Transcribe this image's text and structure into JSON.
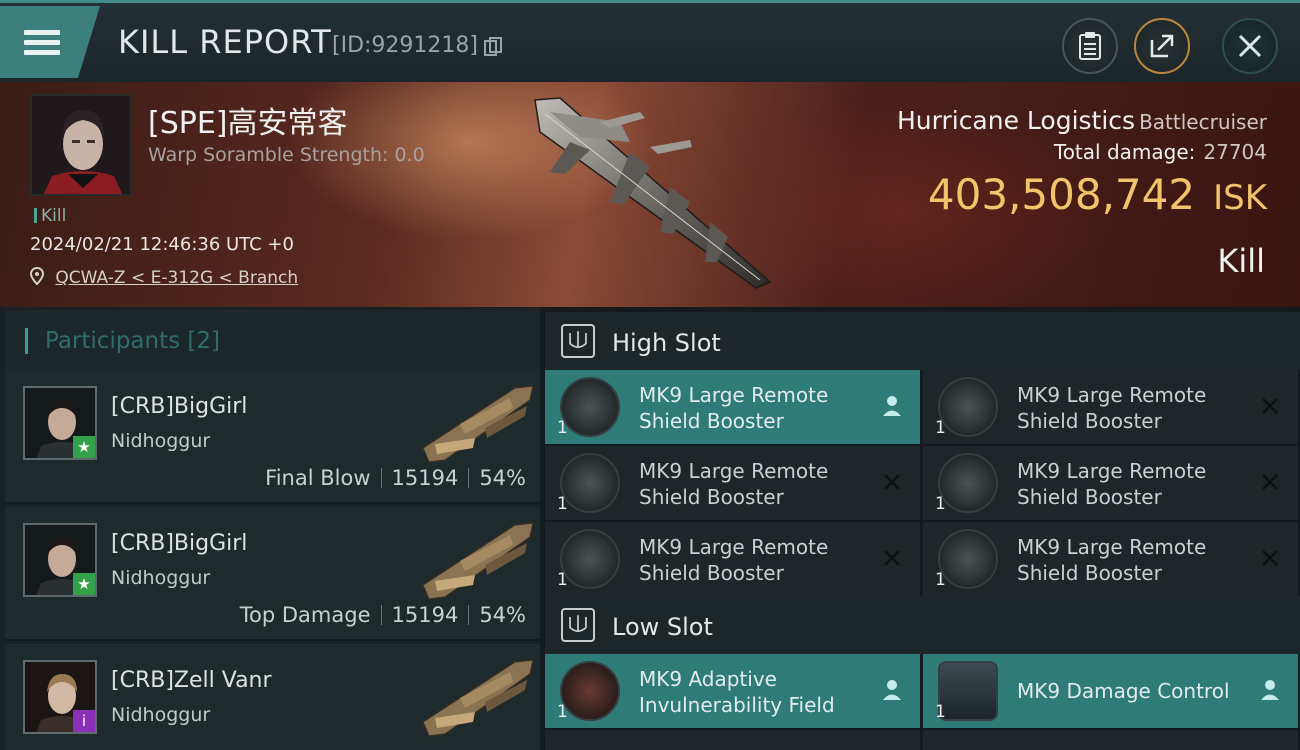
{
  "header": {
    "title": "KILL REPORT",
    "report_id": "[ID:9291218]"
  },
  "victim": {
    "name": "[SPE]高安常客",
    "warp_scramble": "Warp Soramble Strength: 0.0",
    "tag": "Kill",
    "datetime": "2024/02/21 12:46:36 UTC +0",
    "location": "QCWA-Z < E-312G < Branch",
    "ship_name": "Hurricane Logistics",
    "ship_class": "Battlecruiser",
    "total_damage_label": "Total damage:",
    "total_damage": "27704",
    "isk_value": "403,508,742",
    "isk_unit": "ISK",
    "result": "Kill"
  },
  "participants": {
    "label": "Participants",
    "count": "[2]",
    "rows": [
      {
        "name": "[CRB]BigGirl",
        "ship": "Nidhoggur",
        "role": "Final Blow",
        "damage": "15194",
        "percent": "54%",
        "badge": "★"
      },
      {
        "name": "[CRB]BigGirl",
        "ship": "Nidhoggur",
        "role": "Top Damage",
        "damage": "15194",
        "percent": "54%",
        "badge": "★"
      },
      {
        "name": "[CRB]Zell Vanr",
        "ship": "Nidhoggur",
        "role": "",
        "damage": "",
        "percent": "",
        "badge": "i"
      }
    ]
  },
  "slots": {
    "high_label": "High Slot",
    "low_label": "Low Slot",
    "high": [
      {
        "qty": "1",
        "name": "MK9 Large Remote Shield Booster",
        "state": "fitted"
      },
      {
        "qty": "1",
        "name": "MK9 Large Remote Shield Booster",
        "state": "destroyed"
      },
      {
        "qty": "1",
        "name": "MK9 Large Remote Shield Booster",
        "state": "destroyed"
      },
      {
        "qty": "1",
        "name": "MK9 Large Remote Shield Booster",
        "state": "destroyed"
      },
      {
        "qty": "1",
        "name": "MK9 Large Remote Shield Booster",
        "state": "destroyed"
      },
      {
        "qty": "1",
        "name": "MK9 Large Remote Shield Booster",
        "state": "destroyed"
      }
    ],
    "low": [
      {
        "qty": "1",
        "name": "MK9 Adaptive Invulnerability Field",
        "state": "fitted"
      },
      {
        "qty": "1",
        "name": "MK9 Damage Control",
        "state": "fitted"
      }
    ]
  },
  "colors": {
    "accent": "#3d7f7c",
    "isk": "#f0c46a",
    "active_slot": "#2f7b77"
  }
}
